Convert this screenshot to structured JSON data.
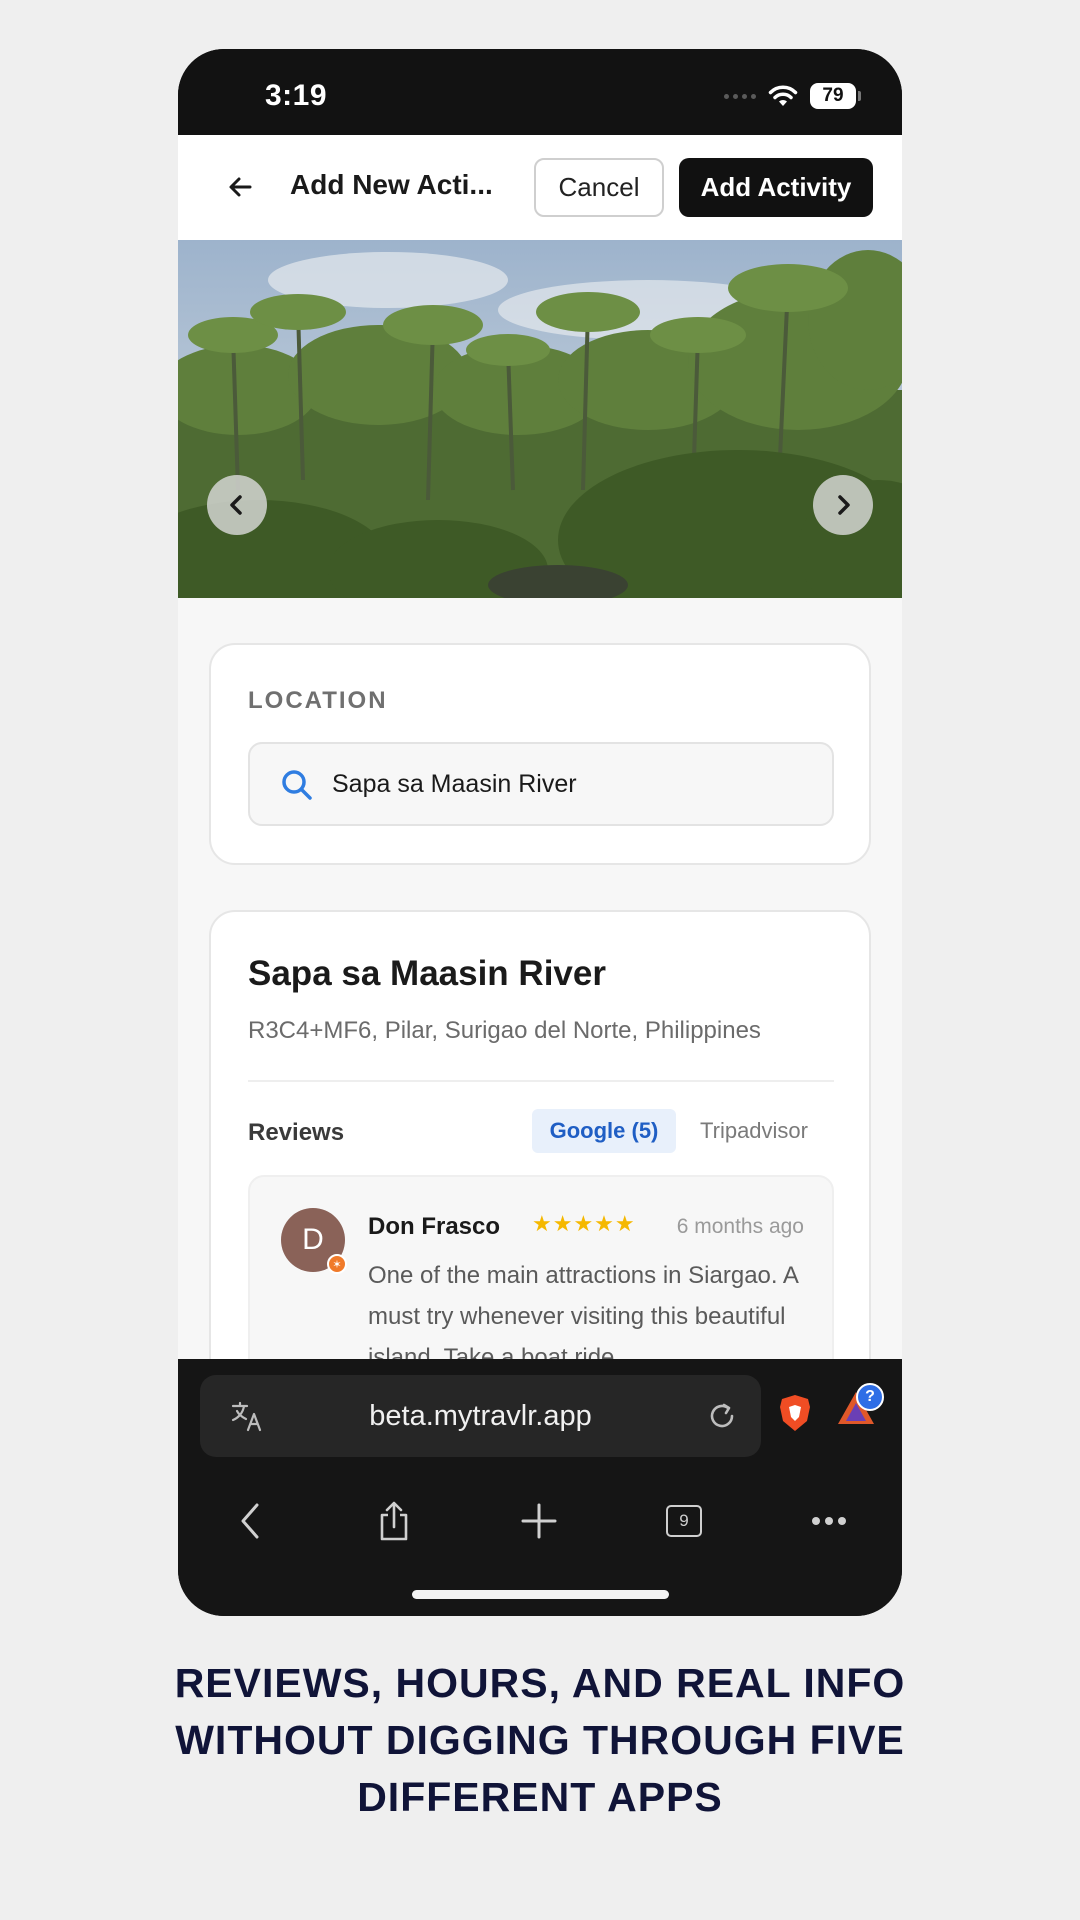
{
  "status_bar": {
    "time": "3:19",
    "battery": "79"
  },
  "header": {
    "title": "Add New Acti...",
    "cancel_label": "Cancel",
    "add_label": "Add Activity"
  },
  "location": {
    "label": "LOCATION",
    "search_value": "Sapa sa Maasin River"
  },
  "place": {
    "name": "Sapa sa Maasin River",
    "address": "R3C4+MF6, Pilar, Surigao del Norte, Philippines"
  },
  "reviews": {
    "label": "Reviews",
    "tabs": [
      "Google (5)",
      "Tripadvisor"
    ],
    "active_tab": "Google (5)",
    "items": [
      {
        "initial": "D",
        "name": "Don Frasco",
        "stars": "★★★★★",
        "rating": 5,
        "time": "6 months ago",
        "text": "One of the main attractions in Siargao. A must try whenever visiting this beautiful island. Take a boat ride"
      }
    ]
  },
  "browser": {
    "url": "beta.mytravlr.app",
    "tab_count": "9",
    "help_badge": "?"
  },
  "caption": "REVIEWS, HOURS, AND REAL INFO WITHOUT DIGGING THROUGH FIVE DIFFERENT APPS",
  "colors": {
    "background": "#efefef",
    "primary_button": "#111111",
    "google_tab_bg": "#e8f0fb",
    "google_tab_text": "#1f5ec4",
    "star": "#f5b800",
    "caption": "#101438"
  }
}
